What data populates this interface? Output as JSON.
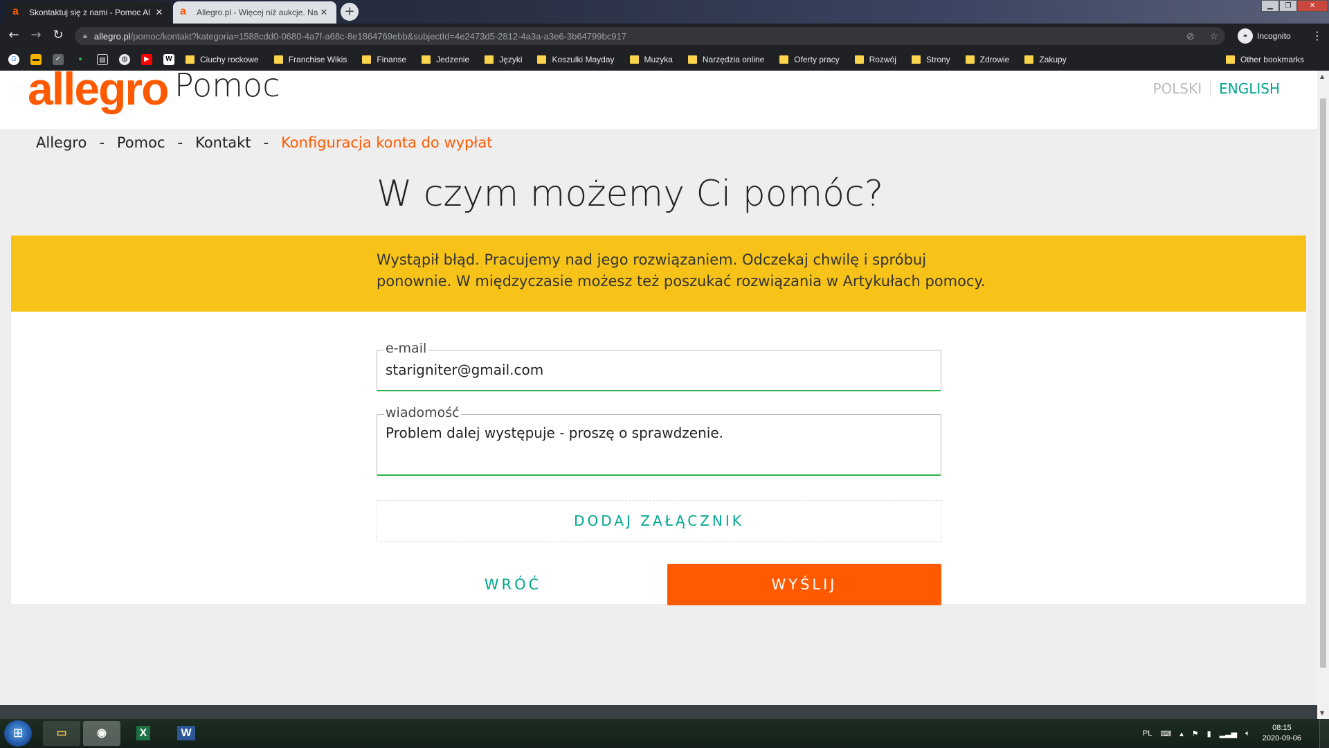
{
  "browser": {
    "tabs": [
      {
        "title": "Skontaktuj się z nami - Pomoc Al",
        "favicon": "a",
        "active": true
      },
      {
        "title": "Allegro.pl - Więcej niż aukcje. Na",
        "favicon": "a",
        "active": false
      }
    ],
    "new_tab": "+",
    "address": {
      "domain": "allegro.pl",
      "path": "/pomoc/kontakt?kategoria=1588cdd0-0680-4a7f-a68c-8e1864769ebb&subjectId=4e2473d5-2812-4a3a-a3e6-3b64799bc917"
    },
    "profile_label": "Incognito",
    "bookmarks": [
      "Ciuchy rockowe",
      "Franchise Wikis",
      "Finanse",
      "Jedzenie",
      "Języki",
      "Koszulki Mayday",
      "Muzyka",
      "Narzędzia online",
      "Oferty pracy",
      "Rozwój",
      "Strony",
      "Zdrowie",
      "Zakupy"
    ],
    "other_bookmarks": "Other bookmarks"
  },
  "header": {
    "logo": "allegro",
    "logo_sub": "Pomoc",
    "lang_polski": "POLSKI",
    "lang_english": "ENGLISH"
  },
  "breadcrumb": {
    "items": [
      "Allegro",
      "Pomoc",
      "Kontakt"
    ],
    "separator": "-",
    "current": "Konfiguracja konta do wypłat"
  },
  "main": {
    "title": "W czym możemy Ci pomóc?",
    "error_line1": "Wystąpił błąd. Pracujemy nad jego rozwiązaniem. Odczekaj chwilę i spróbuj",
    "error_line2": "ponownie. W międzyczasie możesz też poszukać rozwiązania w Artykułach pomocy.",
    "email_label": "e-mail",
    "email_value": "starigniter@gmail.com",
    "message_label": "wiadomość",
    "message_value": "Problem dalej występuje - proszę o sprawdzenie.",
    "attach_label": "DODAJ ZAŁĄCZNIK",
    "back_label": "WRÓĆ",
    "send_label": "WYŚLIJ"
  },
  "taskbar": {
    "language": "PL",
    "time": "08:15",
    "date": "2020-09-06"
  },
  "colors": {
    "brand_orange": "#ff5a00",
    "accent_teal": "#00a790",
    "error_yellow": "#f7c318",
    "field_valid_green": "#2db34a"
  }
}
